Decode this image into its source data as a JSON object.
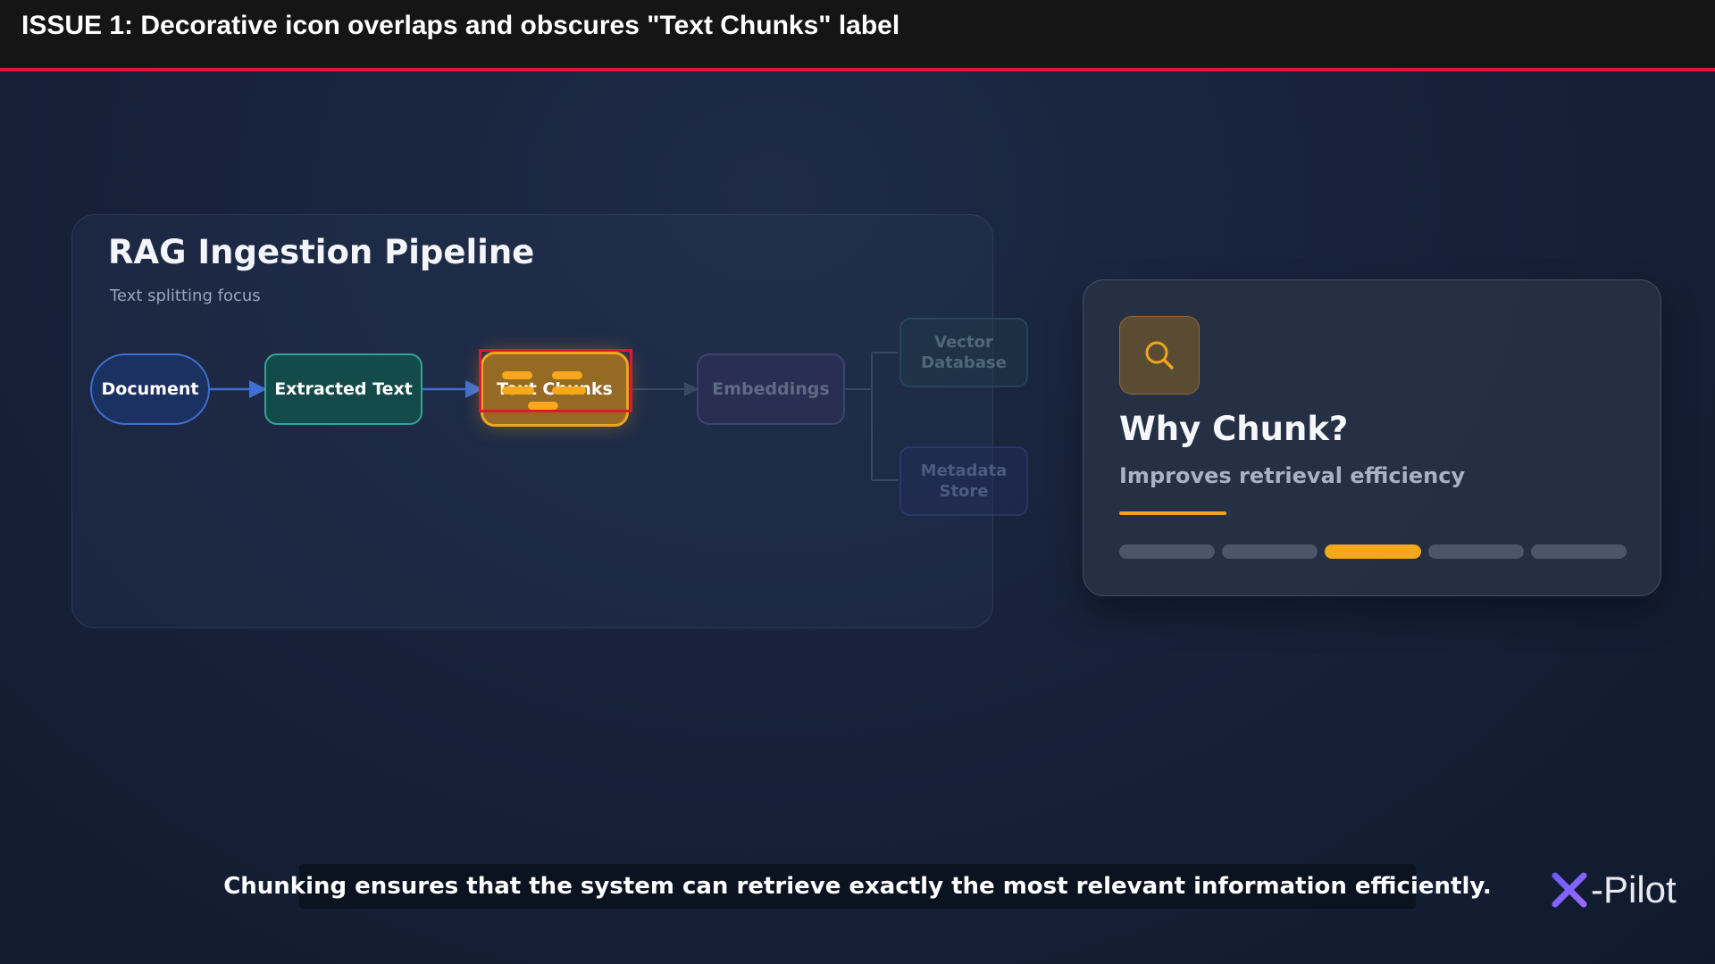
{
  "header": {
    "issue_title": "ISSUE 1: Decorative icon overlaps and obscures \"Text Chunks\" label"
  },
  "pipeline": {
    "title": "RAG Ingestion Pipeline",
    "subtitle": "Text splitting focus",
    "nodes": {
      "document": "Document",
      "extracted_text": "Extracted Text",
      "text_chunks": "Text Chunks",
      "embeddings": "Embeddings",
      "vector_database": "Vector Database",
      "metadata_store": "Metadata Store"
    }
  },
  "info_card": {
    "icon": "search-icon",
    "title": "Why Chunk?",
    "subtitle": "Improves retrieval efficiency",
    "progress": {
      "total_steps": 5,
      "active_step": 3
    }
  },
  "caption": "Chunking ensures that the system can retrieve exactly the most relevant information efficiently.",
  "brand": {
    "name": "-Pilot",
    "icon": "x-logo-icon"
  },
  "colors": {
    "accent_orange": "#f0a51f",
    "issue_red": "#e0182f",
    "document_blue": "#3f6fd0",
    "extracted_teal": "#2fa597"
  }
}
